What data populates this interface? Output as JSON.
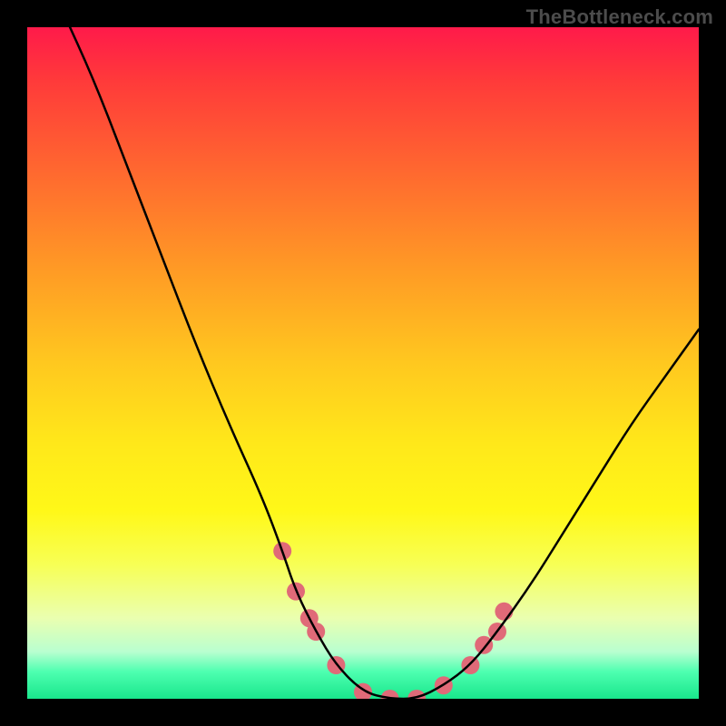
{
  "watermark": "TheBottleneck.com",
  "chart_data": {
    "type": "line",
    "title": "",
    "xlabel": "",
    "ylabel": "",
    "xlim": [
      0,
      100
    ],
    "ylim": [
      0,
      100
    ],
    "series": [
      {
        "name": "bottleneck-curve",
        "x": [
          5,
          10,
          15,
          20,
          25,
          30,
          35,
          38,
          40,
          43,
          46,
          50,
          54,
          58,
          62,
          66,
          70,
          75,
          80,
          85,
          90,
          95,
          100
        ],
        "y": [
          103,
          92,
          79,
          66,
          53,
          41,
          30,
          22,
          16,
          10,
          5,
          1,
          0,
          0,
          2,
          5,
          10,
          17,
          25,
          33,
          41,
          48,
          55
        ]
      }
    ],
    "markers": {
      "name": "highlight-dots",
      "x": [
        38,
        40,
        42,
        43,
        46,
        50,
        54,
        58,
        62,
        66,
        68,
        70,
        71
      ],
      "y": [
        22,
        16,
        12,
        10,
        5,
        1,
        0,
        0,
        2,
        5,
        8,
        10,
        13
      ],
      "color": "#e06a78",
      "radius": 10
    },
    "background_gradient": {
      "top": "#ff1a4a",
      "mid": "#ffe81a",
      "bottom": "#19e68c"
    }
  }
}
